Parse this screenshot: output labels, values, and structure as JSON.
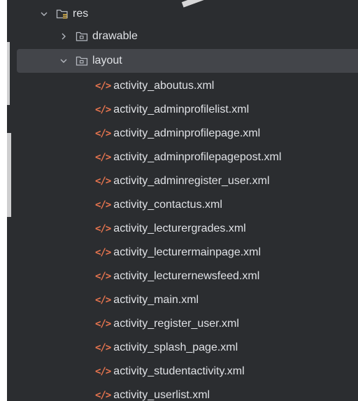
{
  "tree": {
    "root": {
      "label": "res",
      "expanded": true
    },
    "folders": [
      {
        "label": "drawable",
        "expanded": false
      },
      {
        "label": "layout",
        "expanded": true
      }
    ],
    "files": [
      "activity_aboutus.xml",
      "activity_adminprofilelist.xml",
      "activity_adminprofilepage.xml",
      "activity_adminprofilepagepost.xml",
      "activity_adminregister_user.xml",
      "activity_contactus.xml",
      "activity_lecturergrades.xml",
      "activity_lecturermainpage.xml",
      "activity_lecturernewsfeed.xml",
      "activity_main.xml",
      "activity_register_user.xml",
      "activity_splash_page.xml",
      "activity_studentactivity.xml",
      "activity_userlist.xml"
    ],
    "file_icon_glyph": "</>"
  },
  "colors": {
    "panel_background": "#2b2d30",
    "selected_row": "#43454a",
    "text": "#dfe1e5",
    "xml_icon": "#e8754f"
  }
}
